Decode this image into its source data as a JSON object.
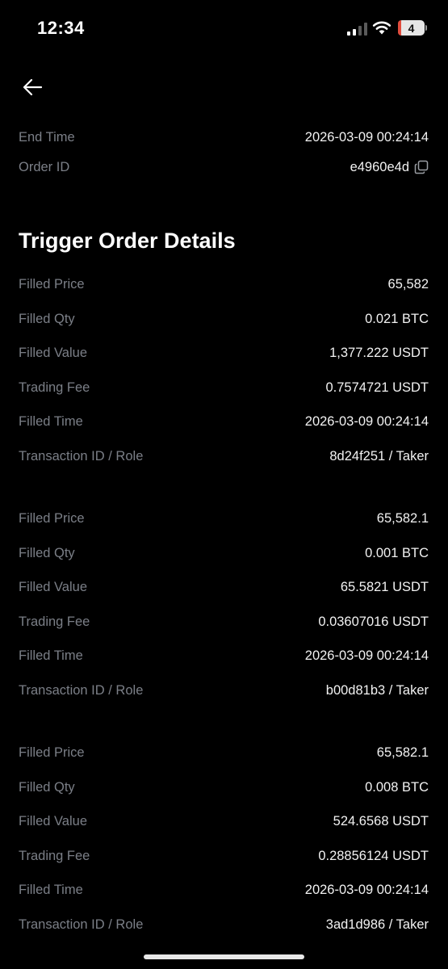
{
  "status_bar": {
    "time": "12:34",
    "battery_level": "4",
    "battery_fraction": 0.12,
    "icons": [
      "cellular-signal-icon",
      "wifi-icon",
      "battery-icon"
    ]
  },
  "nav": {
    "back_icon": "arrow-left-icon"
  },
  "order_info": {
    "end_time_label": "End Time",
    "end_time_value": "2026-03-09 00:24:14",
    "order_id_label": "Order ID",
    "order_id_value": "e4960e4d"
  },
  "section_title": "Trigger Order Details",
  "fills": [
    {
      "price_label": "Filled Price",
      "price": "65,582",
      "qty_label": "Filled Qty",
      "qty": "0.021 BTC",
      "value_label": "Filled Value",
      "value": "1,377.222 USDT",
      "fee_label": "Trading Fee",
      "fee": "0.7574721 USDT",
      "time_label": "Filled Time",
      "time": "2026-03-09 00:24:14",
      "tx_label": "Transaction ID / Role",
      "tx": "8d24f251 / Taker"
    },
    {
      "price_label": "Filled Price",
      "price": "65,582.1",
      "qty_label": "Filled Qty",
      "qty": "0.001 BTC",
      "value_label": "Filled Value",
      "value": "65.5821 USDT",
      "fee_label": "Trading Fee",
      "fee": "0.03607016 USDT",
      "time_label": "Filled Time",
      "time": "2026-03-09 00:24:14",
      "tx_label": "Transaction ID / Role",
      "tx": "b00d81b3 / Taker"
    },
    {
      "price_label": "Filled Price",
      "price": "65,582.1",
      "qty_label": "Filled Qty",
      "qty": "0.008 BTC",
      "value_label": "Filled Value",
      "value": "524.6568 USDT",
      "fee_label": "Trading Fee",
      "fee": "0.28856124 USDT",
      "time_label": "Filled Time",
      "time": "2026-03-09 00:24:14",
      "tx_label": "Transaction ID / Role",
      "tx": "3ad1d986 / Taker"
    }
  ],
  "colors": {
    "background": "#000000",
    "label": "#7b7f87",
    "value": "#f2f2f2",
    "battery_low": "#e04b3c"
  }
}
